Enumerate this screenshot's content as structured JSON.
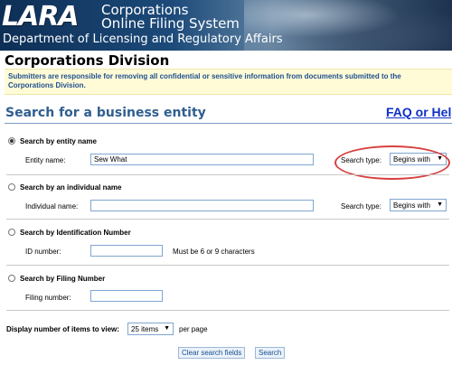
{
  "header": {
    "logo_text": "LARA",
    "title_line1": "Corporations",
    "title_line2": "Online Filing System",
    "department": "Department of Licensing and Regulatory Affairs"
  },
  "division_title": "Corporations Division",
  "notice": "Submitters are responsible for removing all confidential or sensitive information from documents submitted to the Corporations Division.",
  "section_title": "Search for a business entity",
  "faq_link": "FAQ or Help",
  "search_options": {
    "entity": {
      "radio_label": "Search by entity name",
      "selected": true,
      "field_label": "Entity name:",
      "value": "Sew What",
      "search_type_label": "Search type:",
      "search_type_value": "Begins with"
    },
    "individual": {
      "radio_label": "Search by an individual name",
      "selected": false,
      "field_label": "Individual name:",
      "value": "",
      "search_type_label": "Search type:",
      "search_type_value": "Begins with"
    },
    "id_number": {
      "radio_label": "Search by Identification Number",
      "selected": false,
      "field_label": "ID number:",
      "value": "",
      "hint": "Must be 6 or 9 characters"
    },
    "filing_number": {
      "radio_label": "Search by Filing Number",
      "selected": false,
      "field_label": "Filing number:",
      "value": ""
    }
  },
  "display": {
    "label": "Display number of items to view:",
    "value": "25 items",
    "suffix": "per page"
  },
  "buttons": {
    "clear": "Clear search fields",
    "search": "Search"
  },
  "colors": {
    "accent_blue": "#2f5e8f",
    "link_blue": "#0e30c8",
    "notice_bg": "#fffbd6",
    "highlight_red": "#d94040"
  }
}
